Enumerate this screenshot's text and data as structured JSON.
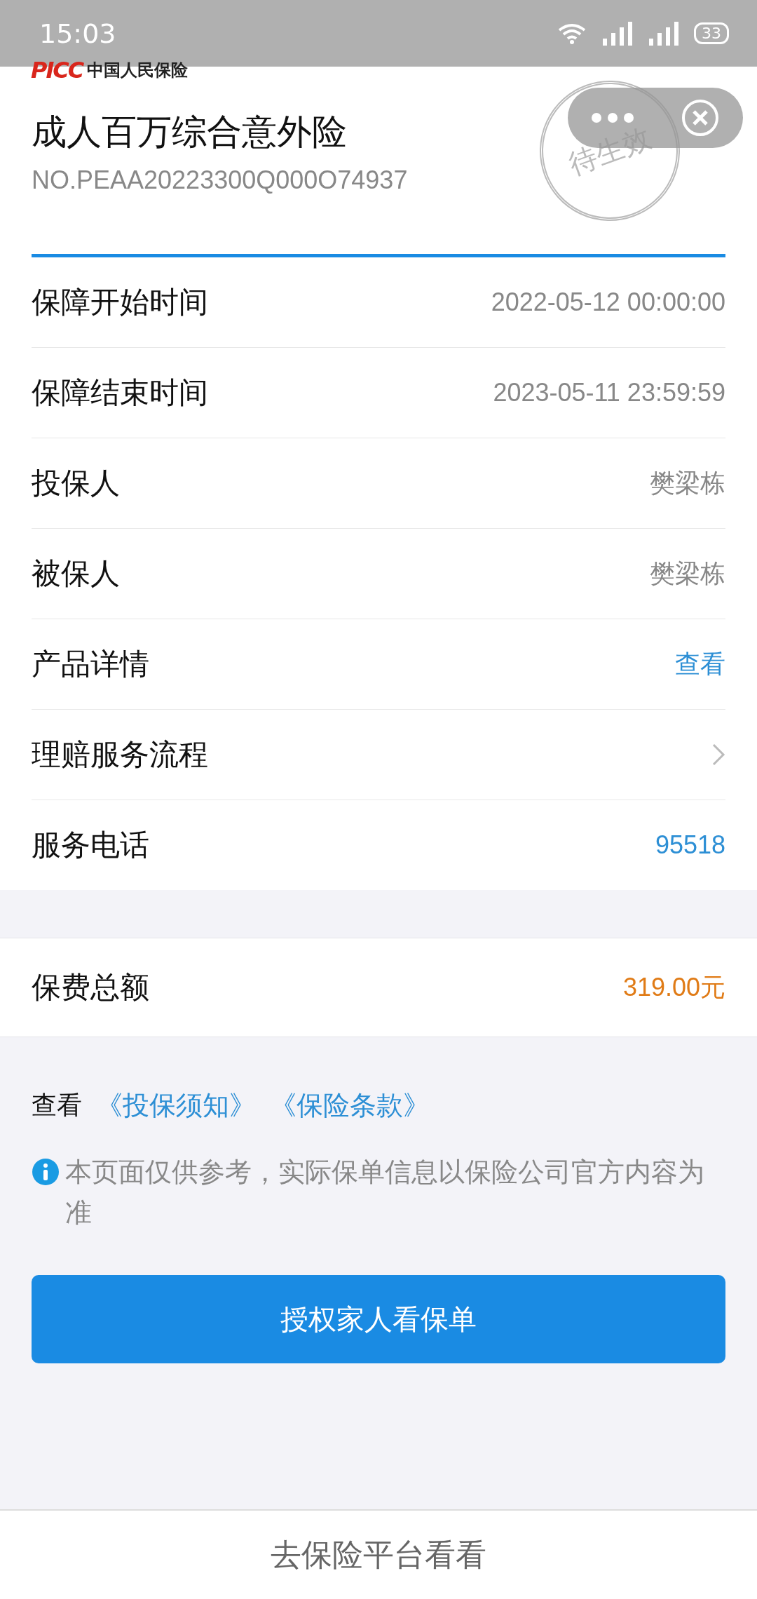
{
  "status_bar": {
    "time": "15:03",
    "battery": "33"
  },
  "header": {
    "logo_mark": "PICC",
    "logo_text": "中国人民保险",
    "title": "成人百万综合意外险",
    "policy_no": "NO.PEAA20223300Q000O74937",
    "stamp": "待生效"
  },
  "rows": [
    {
      "kind": "text",
      "label": "保障开始时间",
      "value": "2022-05-12 00:00:00"
    },
    {
      "kind": "text",
      "label": "保障结束时间",
      "value": "2023-05-11 23:59:59"
    },
    {
      "kind": "text",
      "label": "投保人",
      "value": "樊梁栋"
    },
    {
      "kind": "text",
      "label": "被保人",
      "value": "樊梁栋"
    },
    {
      "kind": "link",
      "label": "产品详情",
      "value": "查看"
    },
    {
      "kind": "chevron",
      "label": "理赔服务流程"
    },
    {
      "kind": "link",
      "label": "服务电话",
      "value": "95518"
    }
  ],
  "premium": {
    "label": "保费总额",
    "value": "319.00元"
  },
  "documents": {
    "lead": "查看",
    "links": [
      "《投保须知》",
      "《保险条款》"
    ]
  },
  "notice": "本页面仅供参考，实际保单信息以保险公司官方内容为准",
  "authorize_button": "授权家人看保单",
  "bottom_button": "去保险平台看看"
}
